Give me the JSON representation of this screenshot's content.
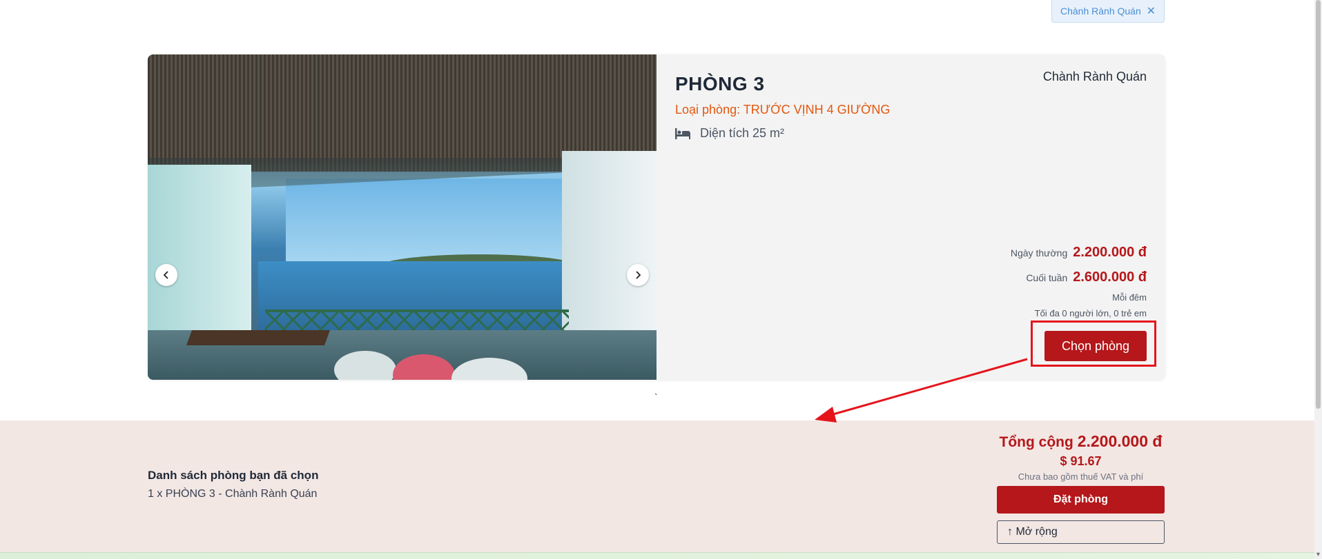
{
  "filter_chip": {
    "label": "Chành Rành Quán",
    "close_icon": "close-icon"
  },
  "room": {
    "title": "PHÒNG 3",
    "hotel": "Chành Rành Quán",
    "type_text": "Loại phòng: TRƯỚC VỊNH 4 GIƯỜNG",
    "area_icon": "bed-icon",
    "area_text": "Diện tích 25 m²",
    "weekday_label": "Ngày thường",
    "weekday_price": "2.200.000 đ",
    "weekend_label": "Cuối tuần",
    "weekend_price": "2.600.000 đ",
    "per_night": "Mỗi đêm",
    "max_guests": "Tối đa 0 người lớn, 0 trẻ em",
    "choose_label": "Chọn phòng",
    "photo_prev_icon": "chevron-left-icon",
    "photo_next_icon": "chevron-right-icon"
  },
  "stray_mark": "`",
  "summary": {
    "title": "Danh sách phòng bạn đã chọn",
    "items": [
      "1 x PHÒNG 3 - Chành Rành Quán"
    ],
    "total_label": "Tổng cộng",
    "total_value": "2.200.000 đ",
    "usd_value": "$ 91.67",
    "vat_note": "Chưa bao gồm thuế VAT và phí",
    "book_label": "Đặt phòng",
    "expand_label": "↑ Mở rộng"
  },
  "colors": {
    "brand_red": "#b5171a",
    "room_type_orange": "#e4570f",
    "annotation_red": "#e5141b",
    "summary_bg": "#f3e7e4"
  }
}
